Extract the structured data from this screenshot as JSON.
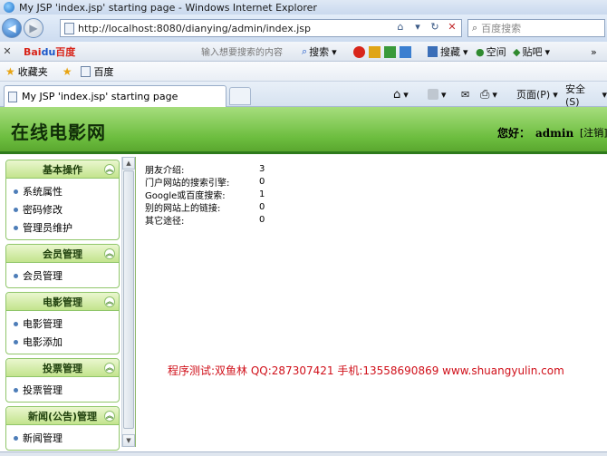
{
  "window": {
    "title": "My JSP 'index.jsp' starting page - Windows Internet Explorer"
  },
  "addressbar": {
    "url": "http://localhost:8080/dianying/admin/index.jsp",
    "search_placeholder": "百度搜索"
  },
  "baidu_toolbar": {
    "input_placeholder": "输入想要搜索的内容",
    "search_label": "搜索",
    "collect_label": "搜藏",
    "space_label": "空间",
    "post_label": "贴吧"
  },
  "favorites_bar": {
    "favorites_label": "收藏夹",
    "baidu_link": "百度"
  },
  "tabs": {
    "active_tab_title": "My JSP 'index.jsp' starting page",
    "page_menu": "页面(P)",
    "safety_menu": "安全(S)"
  },
  "page": {
    "site_title": "在线电影网",
    "greeting": "您好：",
    "username": "admin",
    "logout": "[注销]"
  },
  "sidebar": {
    "groups": [
      {
        "title": "基本操作",
        "items": [
          "系统属性",
          "密码修改",
          "管理员维护"
        ]
      },
      {
        "title": "会员管理",
        "items": [
          "会员管理"
        ]
      },
      {
        "title": "电影管理",
        "items": [
          "电影管理",
          "电影添加"
        ]
      },
      {
        "title": "投票管理",
        "items": [
          "投票管理"
        ]
      },
      {
        "title": "新闻(公告)管理",
        "items": [
          "新闻管理"
        ]
      }
    ]
  },
  "stats": [
    {
      "label": "朋友介绍:",
      "value": "3"
    },
    {
      "label": "门户网站的搜索引擎:",
      "value": "0"
    },
    {
      "label": "Google或百度搜索:",
      "value": "1"
    },
    {
      "label": "别的网站上的链接:",
      "value": "0"
    },
    {
      "label": "其它途径:",
      "value": "0"
    }
  ],
  "footer_note": "程序测试:双鱼林 QQ:287307421 手机:13558690869 www.shuangyulin.com",
  "colors": {
    "header_green": "#6cbd3e",
    "header_border": "#2e7a1c",
    "footer_note": "#d0101a"
  }
}
